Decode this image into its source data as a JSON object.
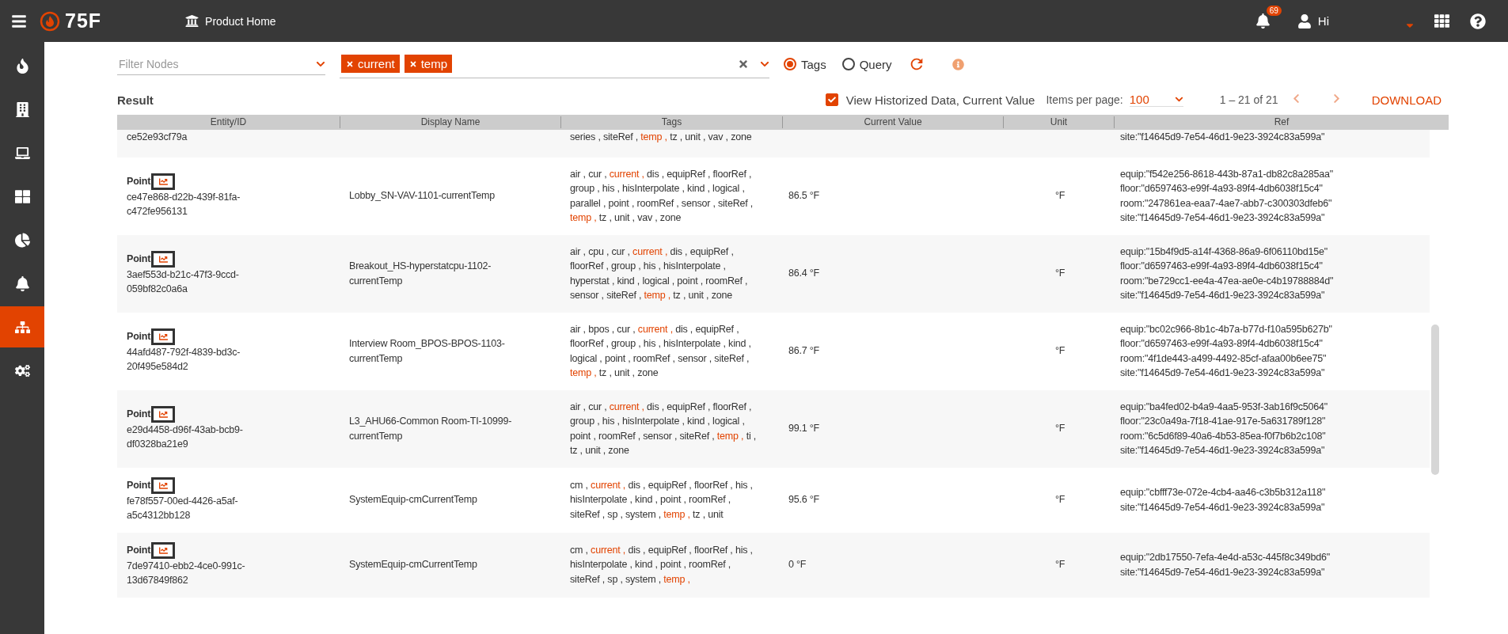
{
  "top_bar": {
    "logo": "75F",
    "home_link": "Product Home",
    "notification_count": "69",
    "greeting": "Hi"
  },
  "sidebar": {
    "items": [
      {
        "selected": false
      },
      {
        "selected": false
      },
      {
        "selected": false
      },
      {
        "selected": false
      },
      {
        "selected": false
      },
      {
        "selected": false
      },
      {
        "selected": true
      },
      {
        "selected": false
      }
    ]
  },
  "filter": {
    "nodes_placeholder": "Filter Nodes",
    "chips": [
      "current",
      "temp"
    ],
    "modes": [
      {
        "label": "Tags",
        "selected": true
      },
      {
        "label": "Query",
        "selected": false
      }
    ]
  },
  "result": {
    "title": "Result",
    "historized": {
      "label": "View Historized Data, Current Value",
      "checked": true
    },
    "items_per_page_label": "Items per page:",
    "items_per_page": "100",
    "range": "1 – 21 of 21",
    "prev": {
      "disabled": true
    },
    "next": {
      "disabled": true
    },
    "download": "DOWNLOAD"
  },
  "table": {
    "columns": [
      "Entity/ID",
      "Display Name",
      "Tags",
      "Current Value",
      "Unit",
      "Ref"
    ],
    "rows": [
      {
        "id": "ce52e93cf79a",
        "tags": [
          {
            "text": "series ,",
            "match": false
          },
          {
            "text": "siteRef ,",
            "match": false
          },
          {
            "text": "temp ,",
            "match": true
          },
          {
            "text": "tz ,",
            "match": false
          },
          {
            "text": "unit ,",
            "match": false
          },
          {
            "text": "vav ,",
            "match": false
          },
          {
            "text": "zone",
            "match": false
          }
        ],
        "ref": [
          "site:\"f14645d9-7e54-46d1-9e23-3924c83a599a\""
        ]
      },
      {
        "type": "Point",
        "id": "ce47e868-d22b-439f-81fa-c472fe956131",
        "display_name": "Lobby_SN-VAV-1101-currentTemp",
        "tags": [
          {
            "text": "air ,",
            "match": false
          },
          {
            "text": "cur ,",
            "match": false
          },
          {
            "text": "current ,",
            "match": true
          },
          {
            "text": "dis ,",
            "match": false
          },
          {
            "text": "equipRef ,",
            "match": false
          },
          {
            "text": "floorRef ,",
            "match": false
          },
          {
            "text": "group ,",
            "match": false
          },
          {
            "text": "his ,",
            "match": false
          },
          {
            "text": "hisInterpolate ,",
            "match": false
          },
          {
            "text": "kind ,",
            "match": false
          },
          {
            "text": "logical ,",
            "match": false
          },
          {
            "text": "parallel ,",
            "match": false
          },
          {
            "text": "point ,",
            "match": false
          },
          {
            "text": "roomRef ,",
            "match": false
          },
          {
            "text": "sensor ,",
            "match": false
          },
          {
            "text": "siteRef ,",
            "match": false
          },
          {
            "text": "temp ,",
            "match": true
          },
          {
            "text": "tz ,",
            "match": false
          },
          {
            "text": "unit ,",
            "match": false
          },
          {
            "text": "vav ,",
            "match": false
          },
          {
            "text": "zone",
            "match": false
          }
        ],
        "value": "86.5 °F",
        "unit": "°F",
        "ref": [
          "equip:\"f542e256-8618-443b-87a1-db82c8a285aa\"",
          "floor:\"d6597463-e99f-4a93-89f4-4db6038f15c4\"",
          "room:\"247861ea-eaa7-4ae7-abb7-c300303dfeb6\"",
          "site:\"f14645d9-7e54-46d1-9e23-3924c83a599a\""
        ]
      },
      {
        "type": "Point",
        "id": "3aef553d-b21c-47f3-9ccd-059bf82c0a6a",
        "display_name": "Breakout_HS-hyperstatcpu-1102-currentTemp",
        "tags": [
          {
            "text": "air ,",
            "match": false
          },
          {
            "text": "cpu ,",
            "match": false
          },
          {
            "text": "cur ,",
            "match": false
          },
          {
            "text": "current ,",
            "match": true
          },
          {
            "text": "dis ,",
            "match": false
          },
          {
            "text": "equipRef ,",
            "match": false
          },
          {
            "text": "floorRef ,",
            "match": false
          },
          {
            "text": "group ,",
            "match": false
          },
          {
            "text": "his ,",
            "match": false
          },
          {
            "text": "hisInterpolate ,",
            "match": false
          },
          {
            "text": "hyperstat ,",
            "match": false
          },
          {
            "text": "kind ,",
            "match": false
          },
          {
            "text": "logical ,",
            "match": false
          },
          {
            "text": "point ,",
            "match": false
          },
          {
            "text": "roomRef ,",
            "match": false
          },
          {
            "text": "sensor ,",
            "match": false
          },
          {
            "text": "siteRef ,",
            "match": false
          },
          {
            "text": "temp ,",
            "match": true
          },
          {
            "text": "tz ,",
            "match": false
          },
          {
            "text": "unit ,",
            "match": false
          },
          {
            "text": "zone",
            "match": false
          }
        ],
        "value": "86.4 °F",
        "unit": "°F",
        "ref": [
          "equip:\"15b4f9d5-a14f-4368-86a9-6f06110bd15e\"",
          "floor:\"d6597463-e99f-4a93-89f4-4db6038f15c4\"",
          "room:\"be729cc1-ee4a-47ea-ae0e-c4b19788884d\"",
          "site:\"f14645d9-7e54-46d1-9e23-3924c83a599a\""
        ]
      },
      {
        "type": "Point",
        "id": "44afd487-792f-4839-bd3c-20f495e584d2",
        "display_name": "Interview Room_BPOS-BPOS-1103-currentTemp",
        "tags": [
          {
            "text": "air ,",
            "match": false
          },
          {
            "text": "bpos ,",
            "match": false
          },
          {
            "text": "cur ,",
            "match": false
          },
          {
            "text": "current ,",
            "match": true
          },
          {
            "text": "dis ,",
            "match": false
          },
          {
            "text": "equipRef ,",
            "match": false
          },
          {
            "text": "floorRef ,",
            "match": false
          },
          {
            "text": "group ,",
            "match": false
          },
          {
            "text": "his ,",
            "match": false
          },
          {
            "text": "hisInterpolate ,",
            "match": false
          },
          {
            "text": "kind ,",
            "match": false
          },
          {
            "text": "logical ,",
            "match": false
          },
          {
            "text": "point ,",
            "match": false
          },
          {
            "text": "roomRef ,",
            "match": false
          },
          {
            "text": "sensor ,",
            "match": false
          },
          {
            "text": "siteRef ,",
            "match": false
          },
          {
            "text": "temp ,",
            "match": true
          },
          {
            "text": "tz ,",
            "match": false
          },
          {
            "text": "unit ,",
            "match": false
          },
          {
            "text": "zone",
            "match": false
          }
        ],
        "value": "86.7 °F",
        "unit": "°F",
        "ref": [
          "equip:\"bc02c966-8b1c-4b7a-b77d-f10a595b627b\"",
          "floor:\"d6597463-e99f-4a93-89f4-4db6038f15c4\"",
          "room:\"4f1de443-a499-4492-85cf-afaa00b6ee75\"",
          "site:\"f14645d9-7e54-46d1-9e23-3924c83a599a\""
        ]
      },
      {
        "type": "Point",
        "id": "e29d4458-d96f-43ab-bcb9-df0328ba21e9",
        "display_name": "L3_AHU66-Common Room-TI-10999-currentTemp",
        "tags": [
          {
            "text": "air ,",
            "match": false
          },
          {
            "text": "cur ,",
            "match": false
          },
          {
            "text": "current ,",
            "match": true
          },
          {
            "text": "dis ,",
            "match": false
          },
          {
            "text": "equipRef ,",
            "match": false
          },
          {
            "text": "floorRef ,",
            "match": false
          },
          {
            "text": "group ,",
            "match": false
          },
          {
            "text": "his ,",
            "match": false
          },
          {
            "text": "hisInterpolate ,",
            "match": false
          },
          {
            "text": "kind ,",
            "match": false
          },
          {
            "text": "logical ,",
            "match": false
          },
          {
            "text": "point ,",
            "match": false
          },
          {
            "text": "roomRef ,",
            "match": false
          },
          {
            "text": "sensor ,",
            "match": false
          },
          {
            "text": "siteRef ,",
            "match": false
          },
          {
            "text": "temp ,",
            "match": true
          },
          {
            "text": "ti ,",
            "match": false
          },
          {
            "text": "tz ,",
            "match": false
          },
          {
            "text": "unit ,",
            "match": false
          },
          {
            "text": "zone",
            "match": false
          }
        ],
        "value": "99.1 °F",
        "unit": "°F",
        "ref": [
          "equip:\"ba4fed02-b4a9-4aa5-953f-3ab16f9c5064\"",
          "floor:\"23c0a49a-7f18-41ae-917e-5a631789f128\"",
          "room:\"6c5d6f89-40a6-4b53-85ea-f0f7b6b2c108\"",
          "site:\"f14645d9-7e54-46d1-9e23-3924c83a599a\""
        ]
      },
      {
        "type": "Point",
        "id": "fe78f557-00ed-4426-a5af-a5c4312bb128",
        "display_name": "SystemEquip-cmCurrentTemp",
        "tags": [
          {
            "text": "cm ,",
            "match": false
          },
          {
            "text": "current ,",
            "match": true
          },
          {
            "text": "dis ,",
            "match": false
          },
          {
            "text": "equipRef ,",
            "match": false
          },
          {
            "text": "floorRef ,",
            "match": false
          },
          {
            "text": "his ,",
            "match": false
          },
          {
            "text": "hisInterpolate ,",
            "match": false
          },
          {
            "text": "kind ,",
            "match": false
          },
          {
            "text": "point ,",
            "match": false
          },
          {
            "text": "roomRef ,",
            "match": false
          },
          {
            "text": "siteRef ,",
            "match": false
          },
          {
            "text": "sp ,",
            "match": false
          },
          {
            "text": "system ,",
            "match": false
          },
          {
            "text": "temp ,",
            "match": true
          },
          {
            "text": "tz ,",
            "match": false
          },
          {
            "text": "unit",
            "match": false
          }
        ],
        "value": "95.6 °F",
        "unit": "°F",
        "ref": [
          "equip:\"cbfff73e-072e-4cb4-aa46-c3b5b312a118\"",
          "site:\"f14645d9-7e54-46d1-9e23-3924c83a599a\""
        ]
      },
      {
        "type": "Point",
        "id": "7de97410-ebb2-4ce0-991c-13d67849f862",
        "display_name": "SystemEquip-cmCurrentTemp",
        "tags": [
          {
            "text": "cm ,",
            "match": false
          },
          {
            "text": "current ,",
            "match": true
          },
          {
            "text": "dis ,",
            "match": false
          },
          {
            "text": "equipRef ,",
            "match": false
          },
          {
            "text": "floorRef ,",
            "match": false
          },
          {
            "text": "his ,",
            "match": false
          },
          {
            "text": "hisInterpolate ,",
            "match": false
          },
          {
            "text": "kind ,",
            "match": false
          },
          {
            "text": "point ,",
            "match": false
          },
          {
            "text": "roomRef ,",
            "match": false
          },
          {
            "text": "siteRef ,",
            "match": false
          },
          {
            "text": "sp ,",
            "match": false
          },
          {
            "text": "system ,",
            "match": false
          },
          {
            "text": "temp ,",
            "match": true
          }
        ],
        "value": "0 °F",
        "unit": "°F",
        "ref": [
          "equip:\"2db17550-7efa-4e4d-a53c-445f8c349bd6\"",
          "site:\"f14645d9-7e54-46d1-9e23-3924c83a599a\""
        ]
      }
    ]
  }
}
